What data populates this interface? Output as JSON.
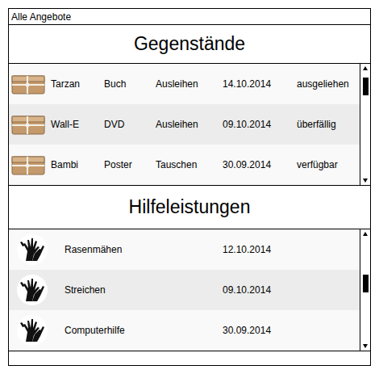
{
  "title": "Alle Angebote",
  "items_section": {
    "heading": "Gegenstände",
    "scroll_position": 0.06,
    "rows": [
      {
        "name": "Tarzan",
        "type": "Buch",
        "action": "Ausleihen",
        "date": "14.10.2014",
        "status": "ausgeliehen",
        "selected": false
      },
      {
        "name": "Wall-E",
        "type": "DVD",
        "action": "Ausleihen",
        "date": "09.10.2014",
        "status": "überfällig",
        "selected": true
      },
      {
        "name": "Bambi",
        "type": "Poster",
        "action": "Tauschen",
        "date": "30.09.2014",
        "status": "verfügbar",
        "selected": false
      }
    ]
  },
  "help_section": {
    "heading": "Hilfeleistungen",
    "scroll_position": 0.43,
    "rows": [
      {
        "name": "Rasenmähen",
        "date": "12.10.2014",
        "selected": false
      },
      {
        "name": "Streichen",
        "date": "09.10.2014",
        "selected": true
      },
      {
        "name": "Computerhilfe",
        "date": "30.09.2014",
        "selected": false
      }
    ]
  }
}
